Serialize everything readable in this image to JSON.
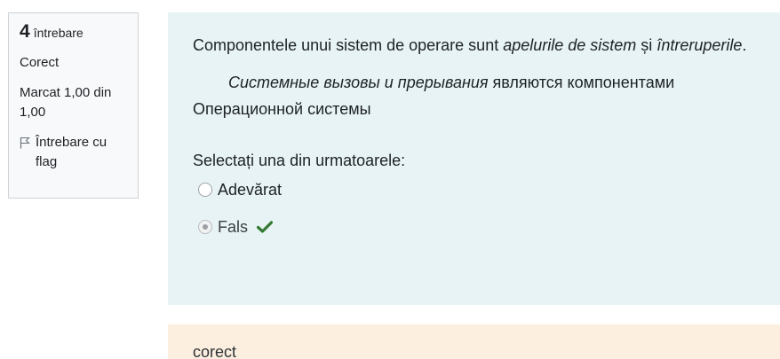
{
  "info": {
    "question_number": "4",
    "question_label": "întrebare",
    "status": "Corect",
    "mark": "Marcat 1,00 din 1,00",
    "flag_label": "Întrebare cu flag",
    "flag_icon": "flag-icon"
  },
  "question": {
    "text_before": "Componentele unui sistem de operare sunt ",
    "text_em1": "apelurile de sistem",
    "text_mid": " și ",
    "text_em2": "întreruperile",
    "text_after": ".",
    "translation_em": "Системные вызовы и прерывания",
    "translation_rest": " являются компонентами Операционной системы",
    "prompt": "Selectați una din urmatoarele:",
    "options": [
      {
        "label": "Adevărat",
        "selected": false
      },
      {
        "label": "Fals",
        "selected": true,
        "marked_correct": true
      }
    ],
    "correct_color": "#357a32"
  },
  "feedback": {
    "text": "corect",
    "background": "#fcefe0"
  }
}
